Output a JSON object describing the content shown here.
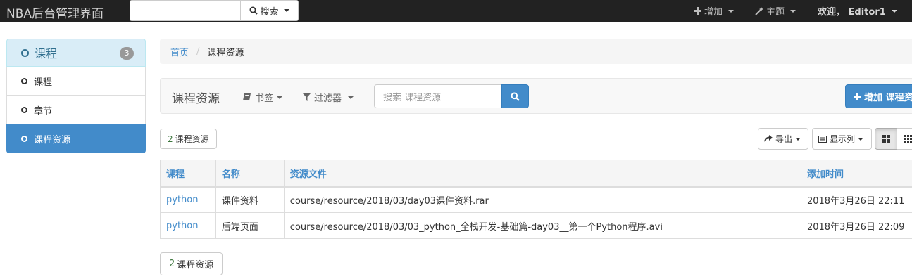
{
  "navbar": {
    "brand": "NBA后台管理界面",
    "search_button": "搜索",
    "add_menu": "增加",
    "theme_menu": "主题",
    "user_menu": "欢迎， Editor1",
    "icons": {
      "search": "search-icon",
      "add": "plus-icon",
      "theme": "wand-icon"
    }
  },
  "sidebar": {
    "header": {
      "label": "课程",
      "badge": "3"
    },
    "items": [
      {
        "label": "课程",
        "active": false
      },
      {
        "label": "章节",
        "active": false
      },
      {
        "label": "课程资源",
        "active": true
      }
    ]
  },
  "breadcrumb": {
    "home": "首页",
    "separator": "/",
    "current": "课程资源"
  },
  "toolbar": {
    "title": "课程资源",
    "bookmarks": "书签",
    "filters": "过滤器",
    "search_placeholder": "搜索 课程资源",
    "add_button": "增加 课程资源"
  },
  "list": {
    "count": "2",
    "count_label": "课程资源",
    "export_button": "导出",
    "columns_button": "显示列"
  },
  "table": {
    "headers": [
      "课程",
      "名称",
      "资源文件",
      "添加时间"
    ],
    "rows": [
      [
        "python",
        "课件资料",
        "course/resource/2018/03/day03课件资料.rar",
        "2018年3月26日 22:11"
      ],
      [
        "python",
        "后端页面",
        "course/resource/2018/03/03_python_全栈开发-基础篇-day03__第一个Python程序.avi",
        "2018年3月26日 22:09"
      ]
    ]
  },
  "colors": {
    "navbar_bg": "#222222",
    "primary": "#428bca",
    "sidebar_header_bg": "#d9edf7",
    "count_green": "#3c763d"
  }
}
